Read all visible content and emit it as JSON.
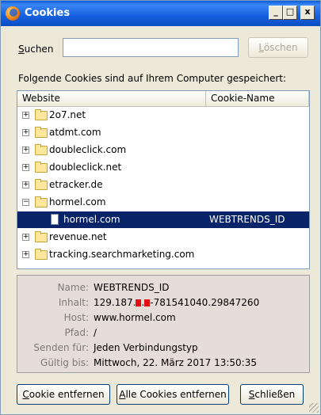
{
  "window": {
    "title": "Cookies"
  },
  "titlebar_buttons": {
    "minimize": "_",
    "maximize": "□",
    "close": "x"
  },
  "search": {
    "label_u": "S",
    "label_rest": "uchen",
    "value": "",
    "placeholder": ""
  },
  "buttons": {
    "loeschen_u": "L",
    "loeschen_rest": "öschen",
    "remove_u": "C",
    "remove_rest": "ookie entfernen",
    "removeall_u": "A",
    "removeall_rest": "lle Cookies entfernen",
    "close_u": "S",
    "close_rest": "chließen"
  },
  "info_text": "Folgende Cookies sind auf Ihrem Computer gespeichert:",
  "tree": {
    "columns": [
      "Website",
      "Cookie-Name"
    ],
    "rows": [
      {
        "type": "folder",
        "expander": "+",
        "site": "2o7.net",
        "cookie": ""
      },
      {
        "type": "folder",
        "expander": "+",
        "site": "atdmt.com",
        "cookie": ""
      },
      {
        "type": "folder",
        "expander": "+",
        "site": "doubleclick.com",
        "cookie": ""
      },
      {
        "type": "folder",
        "expander": "+",
        "site": "doubleclick.net",
        "cookie": ""
      },
      {
        "type": "folder",
        "expander": "+",
        "site": "etracker.de",
        "cookie": ""
      },
      {
        "type": "folder",
        "expander": "−",
        "site": "hormel.com",
        "cookie": ""
      },
      {
        "type": "file",
        "expander": "",
        "site": "hormel.com",
        "cookie": "WEBTRENDS_ID",
        "selected": true
      },
      {
        "type": "folder",
        "expander": "+",
        "site": "revenue.net",
        "cookie": ""
      },
      {
        "type": "folder",
        "expander": "+",
        "site": "tracking.searchmarketing.com",
        "cookie": ""
      }
    ]
  },
  "details": {
    "name": {
      "label": "Name:",
      "value": "WEBTRENDS_ID"
    },
    "inhalt": {
      "label": "Inhalt:",
      "value_pre": "129.187.",
      "value_mid": ".",
      "value_post": "-781541040.29847260"
    },
    "host": {
      "label": "Host:",
      "value": "www.hormel.com"
    },
    "pfad": {
      "label": "Pfad:",
      "value": "/"
    },
    "senden": {
      "label": "Senden für:",
      "value": "Jeden Verbindungstyp"
    },
    "gueltig": {
      "label": "Gültig bis:",
      "value": "Mittwoch, 22. März 2017 13:50:35"
    }
  },
  "colors": {
    "titlebar": "#1560e0",
    "selection": "#0a246a",
    "details_bg": "#e6dcd8",
    "redaction": "#e01010"
  }
}
